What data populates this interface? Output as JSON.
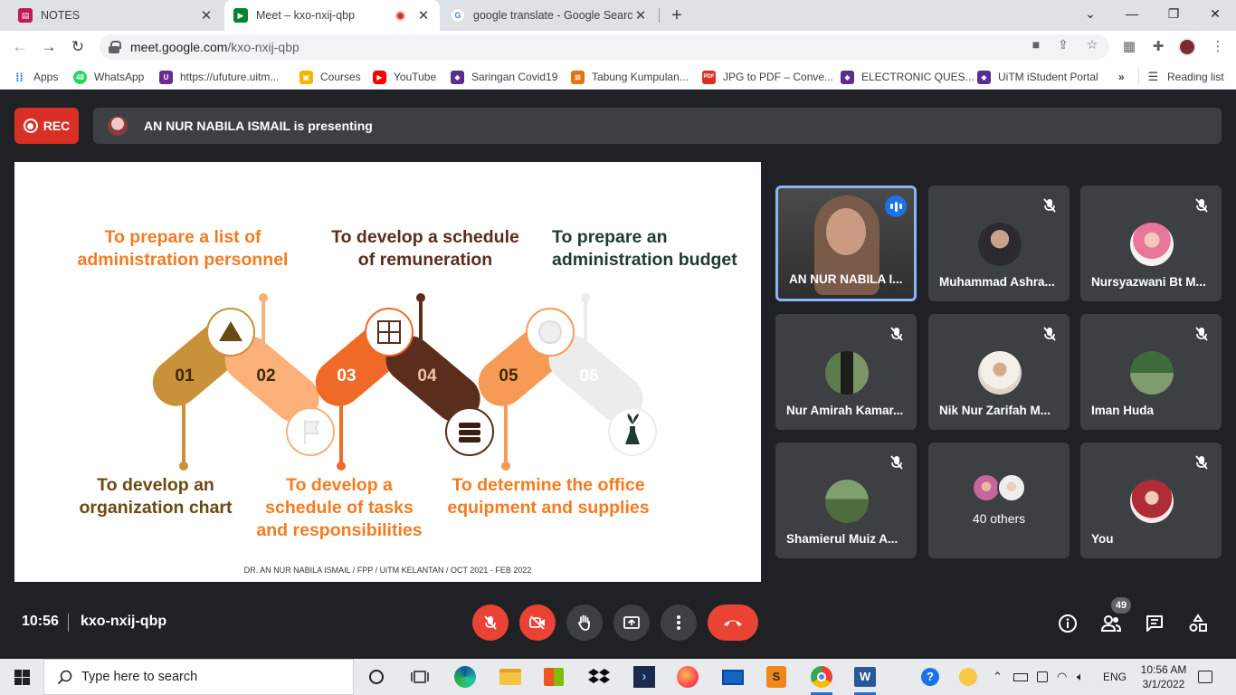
{
  "browser": {
    "tabs": [
      {
        "title": "NOTES",
        "close": "✕"
      },
      {
        "title": "Meet – kxo-nxij-qbp",
        "close": "✕"
      },
      {
        "title": "google translate - Google Search",
        "close": "✕"
      }
    ],
    "new_tab": "+",
    "window_controls": {
      "collapse": "⌄",
      "minimize": "—",
      "maximize": "❐",
      "close": "✕"
    },
    "url_host": "meet.google.com",
    "url_path": "/kxo-nxij-qbp",
    "bookmarks": [
      {
        "label": "Apps",
        "color": "#1a73e8"
      },
      {
        "label": "WhatsApp",
        "color": "#25d366"
      },
      {
        "label": "https://ufuture.uitm...",
        "color": "#6a2c91"
      },
      {
        "label": "Courses",
        "color": "#f4b400"
      },
      {
        "label": "YouTube",
        "color": "#ff0000"
      },
      {
        "label": "Saringan Covid19",
        "color": "#5b2d8e"
      },
      {
        "label": "Tabung Kumpulan...",
        "color": "#e8710a"
      },
      {
        "label": "JPG to PDF – Conve...",
        "color": "#d93025"
      },
      {
        "label": "ELECTRONIC QUES...",
        "color": "#5b2d8e"
      },
      {
        "label": "UiTM iStudent Portal",
        "color": "#5b2d8e"
      }
    ],
    "bookmarks_more": "»",
    "reading_list": "Reading list"
  },
  "meet": {
    "rec_label": "REC",
    "presenting_text": "AN NUR NABILA ISMAIL is presenting",
    "time": "10:56",
    "code": "kxo-nxij-qbp",
    "participant_count": "49",
    "participants": [
      {
        "name": "AN NUR NABILA I...",
        "speaking": true
      },
      {
        "name": "Muhammad Ashra..."
      },
      {
        "name": "Nursyazwani Bt M..."
      },
      {
        "name": "Nur Amirah Kamar..."
      },
      {
        "name": "Nik Nur Zarifah M..."
      },
      {
        "name": "Iman Huda"
      },
      {
        "name": "Shamierul Muiz A..."
      },
      {
        "name": "40 others"
      },
      {
        "name": "You"
      }
    ]
  },
  "slide": {
    "headings_top": [
      {
        "text_1": "To prepare a list of",
        "text_2": "administration personnel",
        "color": "#f47b20"
      },
      {
        "text_1": "To develop a schedule",
        "text_2": "of remuneration",
        "color": "#5a2d1c"
      },
      {
        "text_1": "To prepare an",
        "text_2": "administration budget",
        "color": "#1f3b2d"
      }
    ],
    "headings_bottom": [
      {
        "text_1": "To develop an",
        "text_2": "organization chart",
        "color": "#6b4a12"
      },
      {
        "text_1": "To develop a",
        "text_2": "schedule of tasks",
        "text_3": "and responsibilities",
        "color": "#f47b20"
      },
      {
        "text_1": "To determine the office",
        "text_2": "equipment and supplies",
        "color": "#f47b20"
      }
    ],
    "steps": [
      "01",
      "02",
      "03",
      "04",
      "05",
      "06"
    ],
    "footer": "DR. AN NUR NABILA ISMAIL / FPP / UiTM KELANTAN / OCT 2021 - FEB 2022"
  },
  "taskbar": {
    "search_placeholder": "Type here to search",
    "language": "ENG",
    "time": "10:56 AM",
    "date": "3/1/2022"
  }
}
